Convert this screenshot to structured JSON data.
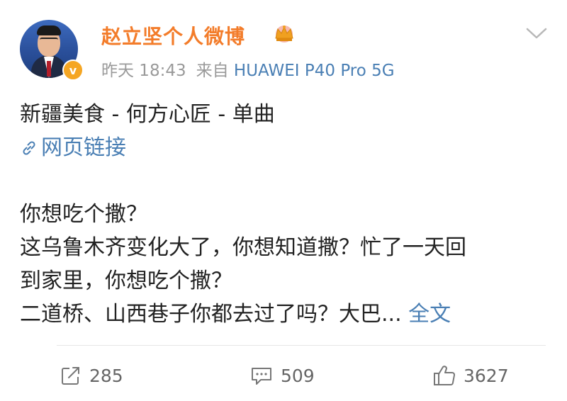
{
  "header": {
    "username": "赵立坚个人微博",
    "timestamp": "昨天 18:43",
    "source_prefix": "来自",
    "source_device": "HUAWEI P40 Pro 5G",
    "verified_badge": "v",
    "icons": {
      "avatar": "avatar",
      "crown": "crown-icon",
      "menu": "chevron-down-icon"
    }
  },
  "post": {
    "title": "新疆美食 - 何方心匠 - 单曲",
    "link_label": "网页链接",
    "lines": [
      "你想吃个撒？",
      "这乌鲁木齐变化大了，你想知道撒？忙了一天回",
      "到家里，你想吃个撒？",
      "二道桥、山西巷子你都去过了吗？大巴..."
    ],
    "more_label": "全文"
  },
  "actions": {
    "repost_count": "285",
    "comment_count": "509",
    "like_count": "3627"
  },
  "colors": {
    "username": "#f37c2a",
    "link": "#4a7fb4",
    "meta": "#9a9a9a",
    "body_text": "#222222",
    "verified": "#f5a623"
  }
}
